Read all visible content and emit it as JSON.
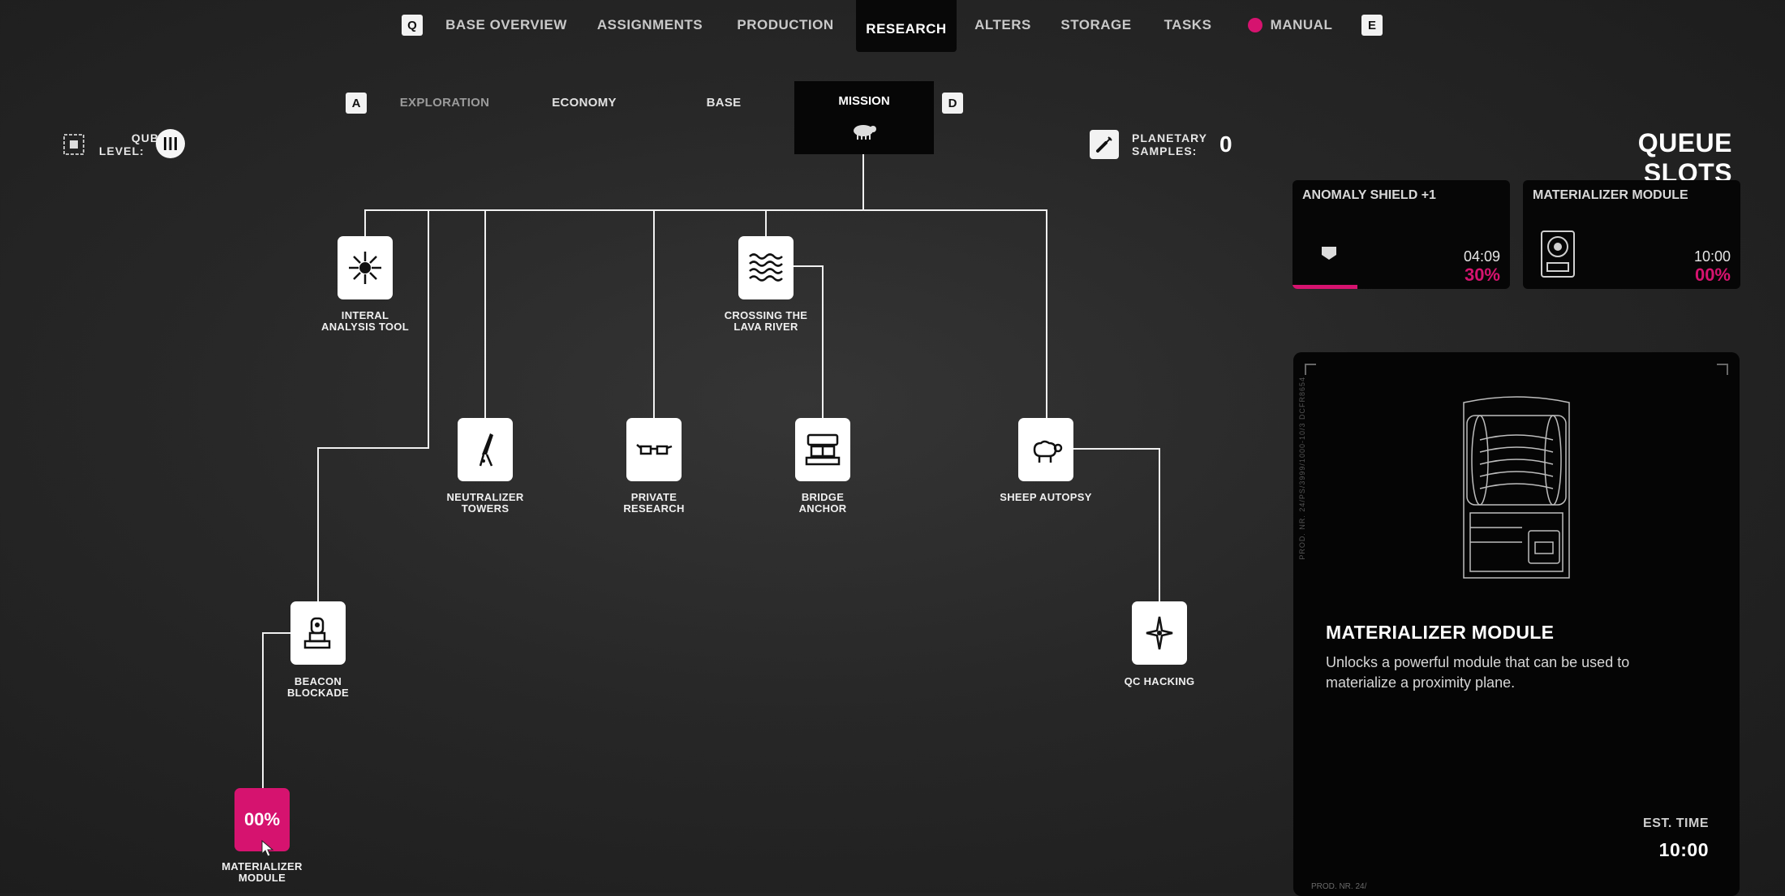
{
  "nav": {
    "left_key": "Q",
    "right_key": "E",
    "tabs": [
      {
        "label": "BASE OVERVIEW"
      },
      {
        "label": "ASSIGNMENTS"
      },
      {
        "label": "PRODUCTION"
      },
      {
        "label": "RESEARCH",
        "active": true
      },
      {
        "label": "ALTERS"
      },
      {
        "label": "STORAGE"
      },
      {
        "label": "TASKS"
      },
      {
        "label": "MANUAL"
      }
    ]
  },
  "subnav": {
    "left_key": "A",
    "right_key": "D",
    "tabs": [
      {
        "label": "EXPLORATION"
      },
      {
        "label": "ECONOMY"
      },
      {
        "label": "BASE"
      },
      {
        "label": "MISSION",
        "active": true,
        "icon": "sheep-icon"
      }
    ]
  },
  "qubit": {
    "label_line1": "QUBIT",
    "label_line2": "LEVEL:",
    "level_icon": "roman-three-icon"
  },
  "samples": {
    "label_line1": "PLANETARY",
    "label_line2": "SAMPLES:",
    "value": "0"
  },
  "tree": {
    "nodes": [
      {
        "id": "interal",
        "label_line1": "INTERAL",
        "label_line2": "ANALYSIS TOOL",
        "icon": "starburst-icon"
      },
      {
        "id": "lava",
        "label_line1": "CROSSING THE",
        "label_line2": "LAVA RIVER",
        "icon": "waves-icon"
      },
      {
        "id": "neutralizer",
        "label_line1": "NEUTRALIZER",
        "label_line2": "TOWERS",
        "icon": "tower-icon"
      },
      {
        "id": "private",
        "label_line1": "PRIVATE",
        "label_line2": "RESEARCH",
        "icon": "glasses-icon"
      },
      {
        "id": "bridge",
        "label_line1": "BRIDGE",
        "label_line2": "ANCHOR",
        "icon": "anchor-machine-icon"
      },
      {
        "id": "sheep",
        "label_line1": "SHEEP AUTOPSY",
        "label_line2": "",
        "icon": "sheep-icon"
      },
      {
        "id": "beacon",
        "label_line1": "BEACON",
        "label_line2": "BLOCKADE",
        "icon": "beacon-icon"
      },
      {
        "id": "qc",
        "label_line1": "QC HACKING",
        "label_line2": "",
        "icon": "sparkle-icon"
      },
      {
        "id": "materializer",
        "label_line1": "MATERIALIZER",
        "label_line2": "MODULE",
        "progress_text": "00%"
      }
    ]
  },
  "queue": {
    "title": "QUEUE SLOTS",
    "slots": [
      {
        "name": "ANOMALY SHIELD +1",
        "time": "04:09",
        "percent": "30%",
        "progress": 0.3,
        "icon": "shield-icon"
      },
      {
        "name": "MATERIALIZER MODULE",
        "time": "10:00",
        "percent": "00%",
        "progress": 0.0,
        "icon": "module-icon"
      }
    ]
  },
  "detail": {
    "title": "MATERIALIZER MODULE",
    "description": "Unlocks a powerful module that can be used to materialize a proximity plane.",
    "est_label": "EST. TIME",
    "est_value": "10:00",
    "serial": "PROD. NR. 24/",
    "vertical_text": "PROD. NR. 24/PS/3999/1000-10/3   DCFR8654"
  },
  "colors": {
    "accent": "#d6136f",
    "panel": "#050505",
    "line": "#f0f0f0"
  }
}
